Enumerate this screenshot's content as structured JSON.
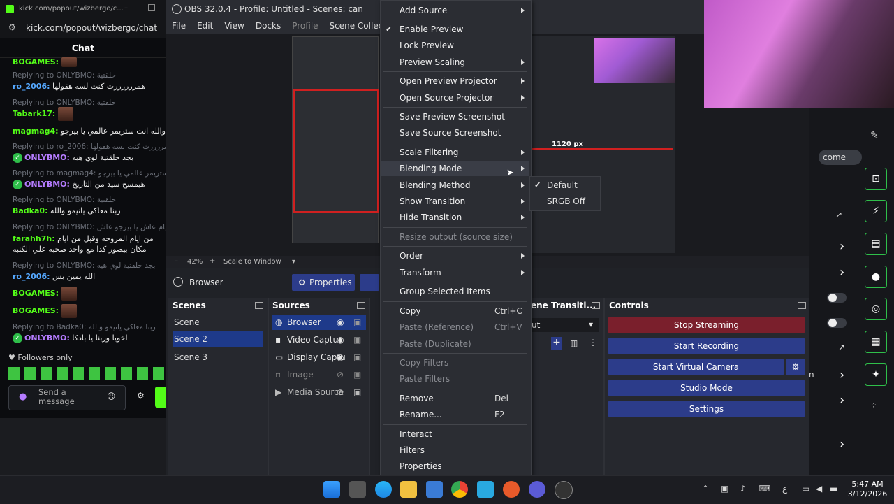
{
  "chat": {
    "tab_title": "kick.com/popout/wizbergo/c...",
    "url": "kick.com/popout/wizbergo/chat",
    "header": "Chat",
    "lines": [
      {
        "user": "BOGAMES:",
        "msg": "",
        "reply": ""
      },
      {
        "reply": "Replying to ONLYBMO: حلقتية",
        "user": "ro_2006:",
        "msg": "همررررررت كنت لسه هقولها"
      },
      {
        "reply": "Replying to ONLYBMO: حلقتية",
        "user": "Tabark17:",
        "msg": ""
      },
      {
        "reply": "",
        "user": "magmag4:",
        "msg": "والله انت ستريمر عالمي يا بيرجو"
      },
      {
        "reply": "Replying to ro_2006: همررررت كنت لسه هقولها",
        "user": "ONLYBMO:",
        "msg": "بجد حلقتية لوي هيه"
      },
      {
        "reply": "Replying to magmag4: انت ستريمر عالمي يا بيرجو",
        "user": "ONLYBMO:",
        "msg": "هيمسح سيد من التاريخ"
      },
      {
        "reply": "Replying to ONLYBMO: حلقتية",
        "user": "Badka0:",
        "msg": "ربنا معاكي يانيمو والله"
      },
      {
        "reply": "Replying to ONLYBMO: من ايام عاش يا بيرجو عاش",
        "user": "farahh7h:",
        "msg": "من ايام المروحه وقبل من ايام مكان بيصور كدا مع واحد صحبه علي الكنبه"
      },
      {
        "reply": "Replying to ONLYBMO: بجد حلقتية لوي هيه",
        "user": "ro_2006:",
        "msg": "الله يمين بس"
      },
      {
        "reply": "",
        "user": "BOGAMES:",
        "msg": ""
      },
      {
        "reply": "",
        "user": "BOGAMES:",
        "msg": ""
      },
      {
        "reply": "Replying to Badka0: ربنا معاكي يانيمو والله",
        "user": "ONLYBMO:",
        "msg": "اخويا وربنا يا بادكا"
      }
    ],
    "followers_only": "Followers only",
    "send_placeholder": "Send a message"
  },
  "obs": {
    "title": "OBS 32.0.4 - Profile: Untitled - Scenes: can",
    "menu": [
      "File",
      "Edit",
      "View",
      "Docks",
      "Profile",
      "Scene Collection",
      "To"
    ],
    "zoom": "42%",
    "scale_mode": "Scale to Window",
    "selected_source": "Browser",
    "properties_btn": "Properties",
    "size_readout": "1120 px",
    "scenes_title": "Scenes",
    "scenes": [
      "Scene",
      "Scene 2",
      "Scene 3"
    ],
    "active_scene_index": 1,
    "sources_title": "Sources",
    "sources": [
      "Browser",
      "Video Captur",
      "Display Captu",
      "Image",
      "Media Source"
    ],
    "transitions_title": "ene Transiti...",
    "transition_value": "ut",
    "controls_title": "Controls",
    "controls": [
      "Stop Streaming",
      "Start Recording",
      "Start Virtual Camera",
      "Studio Mode",
      "Settings"
    ]
  },
  "context_menu": {
    "items": [
      {
        "label": "Add Source",
        "sub": true
      },
      {
        "label": "Enable Preview",
        "check": true
      },
      {
        "label": "Lock Preview"
      },
      {
        "label": "Preview Scaling",
        "sub": true
      },
      {
        "label": "Open Preview Projector",
        "sub": true
      },
      {
        "label": "Open Source Projector",
        "sub": true
      },
      {
        "label": "Save Preview Screenshot"
      },
      {
        "label": "Save Source Screenshot"
      },
      {
        "label": "Scale Filtering",
        "sub": true
      },
      {
        "label": "Blending Mode",
        "sub": true
      },
      {
        "label": "Blending Method",
        "sub": true
      },
      {
        "label": "Show Transition",
        "sub": true
      },
      {
        "label": "Hide Transition",
        "sub": true
      },
      {
        "label": "Resize output (source size)",
        "disabled": true
      },
      {
        "label": "Order",
        "sub": true
      },
      {
        "label": "Transform",
        "sub": true
      },
      {
        "label": "Group Selected Items"
      },
      {
        "label": "Copy",
        "shortcut": "Ctrl+C"
      },
      {
        "label": "Paste (Reference)",
        "shortcut": "Ctrl+V",
        "disabled": true
      },
      {
        "label": "Paste (Duplicate)",
        "disabled": true
      },
      {
        "label": "Copy Filters",
        "disabled": true
      },
      {
        "label": "Paste Filters",
        "disabled": true
      },
      {
        "label": "Remove",
        "shortcut": "Del"
      },
      {
        "label": "Rename...",
        "shortcut": "F2"
      },
      {
        "label": "Interact"
      },
      {
        "label": "Filters"
      },
      {
        "label": "Properties"
      }
    ],
    "submenu": [
      "Default",
      "SRGB Off"
    ]
  },
  "right": {
    "comment_chip": "come",
    "partial_text": "n"
  },
  "taskbar": {
    "time": "5:47 AM",
    "date": "3/12/2026",
    "lang": "ع"
  }
}
